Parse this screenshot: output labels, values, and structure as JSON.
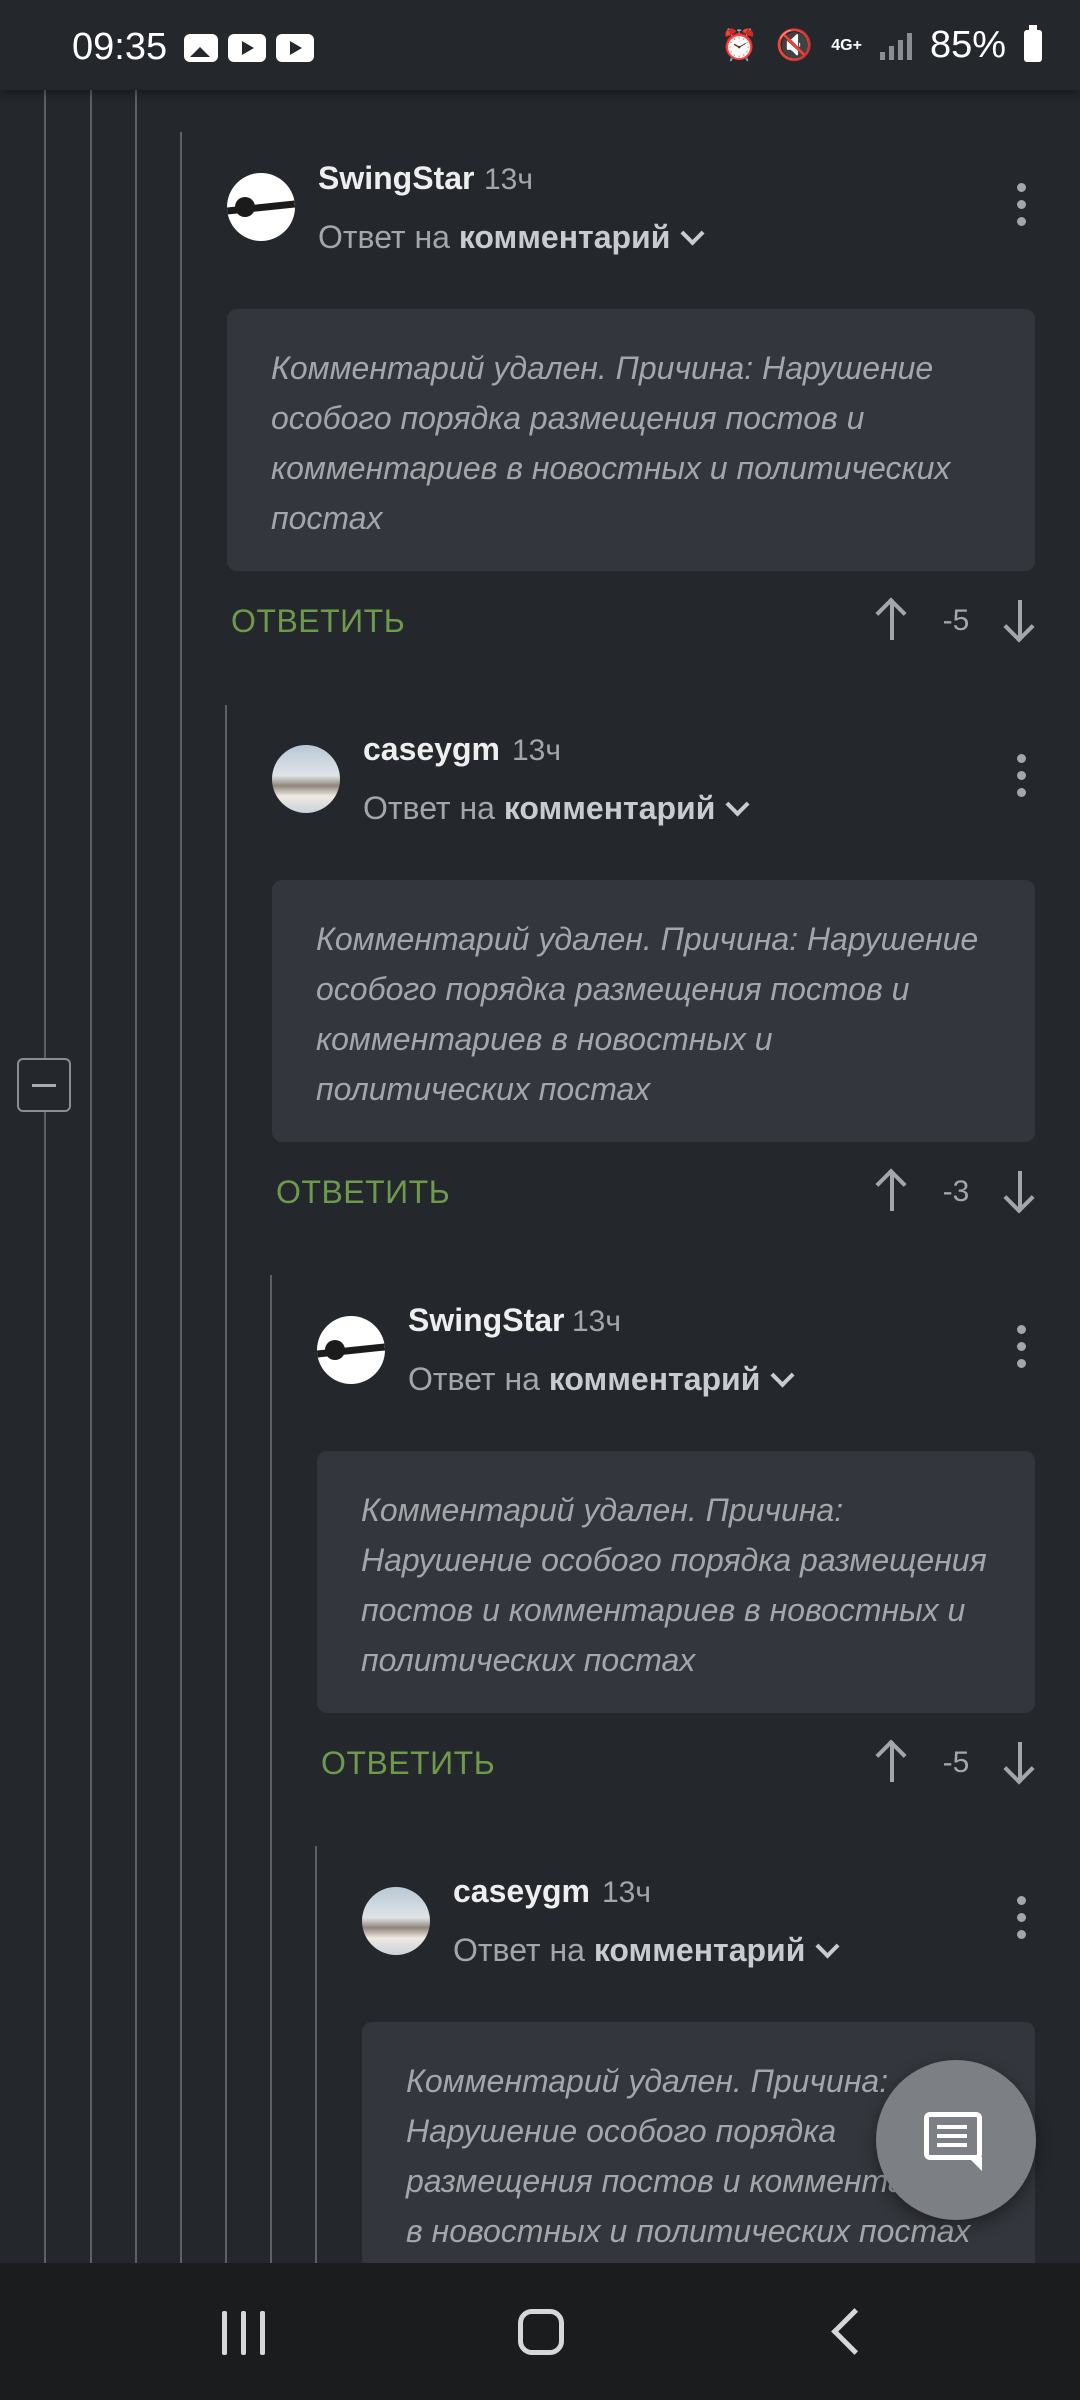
{
  "status_bar": {
    "time": "09:35",
    "network": "4G+",
    "battery": "85%",
    "icons": [
      "image-icon",
      "youtube-icon",
      "youtube-icon",
      "alarm-icon",
      "mute-icon",
      "signal-icon",
      "battery-icon"
    ]
  },
  "comments": [
    {
      "author": "SwingStar",
      "time": "13ч",
      "reply_prefix": "Ответ на",
      "reply_target": "комментарий",
      "body": "Комментарий удален. Причина: Нарушение особого порядка размещения постов и комментариев в новостных и политических постах",
      "reply_label": "ОТВЕТИТЬ",
      "score": "-5",
      "avatar": "guitar-avatar"
    },
    {
      "author": "caseygm",
      "time": "13ч",
      "reply_prefix": "Ответ на",
      "reply_target": "комментарий",
      "body": "Комментарий удален. Причина: Нарушение особого порядка размещения постов и комментариев в новостных и политических постах",
      "reply_label": "ОТВЕТИТЬ",
      "score": "-3",
      "avatar": "mountain-avatar"
    },
    {
      "author": "SwingStar",
      "time": "13ч",
      "reply_prefix": "Ответ на",
      "reply_target": "комментарий",
      "body": "Комментарий удален. Причина: Нарушение особого порядка размещения постов и комментариев в новостных и политических постах",
      "reply_label": "ОТВЕТИТЬ",
      "score": "-5",
      "avatar": "guitar-avatar"
    },
    {
      "author": "caseygm",
      "time": "13ч",
      "reply_prefix": "Ответ на",
      "reply_target": "комментарий",
      "body": "Комментарий удален. Причина: Нарушение особого порядка размещения постов и комментариев в новостных и политических постах",
      "avatar": "mountain-avatar"
    }
  ],
  "colors": {
    "background": "#24282d",
    "card": "#33363c",
    "reply_accent": "#6d9a4b",
    "fab": "#7c7f84"
  }
}
